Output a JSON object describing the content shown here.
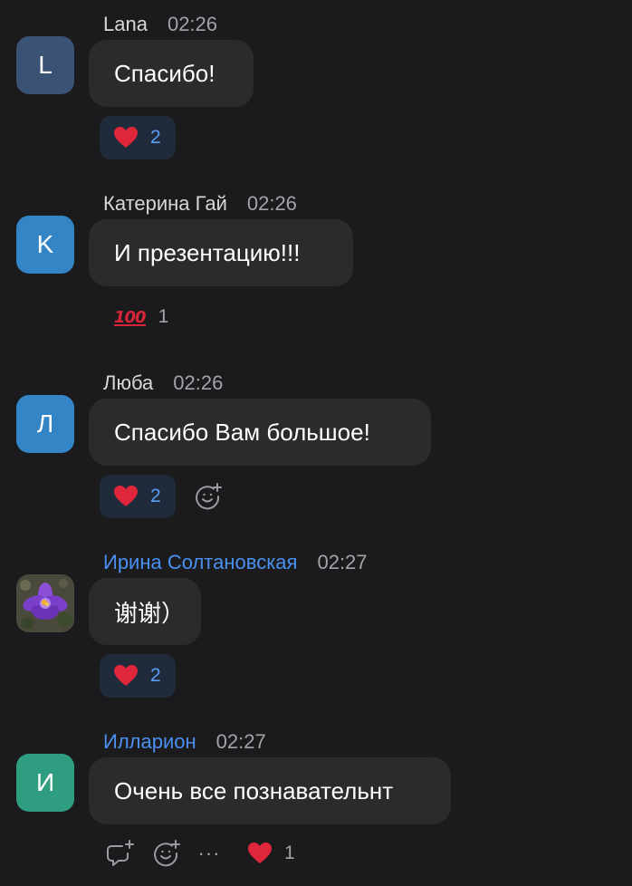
{
  "colors": {
    "background": "#1b1b1d",
    "bubble": "#2b2b2e",
    "reaction_active_bg": "#1f2a3b",
    "reaction_active_text": "#5a9ef5",
    "name_blue": "#4a90f0",
    "heart": "#e0263b"
  },
  "messages": [
    {
      "sender": "Lana",
      "time": "02:26",
      "avatar_letter": "L",
      "avatar_color": "#3a5273",
      "text": "Спасибо!",
      "reactions": [
        {
          "emoji": "heart-icon",
          "count": "2",
          "selected": true
        }
      ]
    },
    {
      "sender": "Катерина Гай",
      "time": "02:26",
      "avatar_letter": "K",
      "avatar_color": "#3385c6",
      "text": "И презентацию!!!",
      "reactions": [
        {
          "emoji": "hundred-points-icon",
          "count": "1",
          "selected": false
        }
      ]
    },
    {
      "sender": "Люба",
      "time": "02:26",
      "avatar_letter": "Л",
      "avatar_color": "#3385c6",
      "text": "Спасибо Вам большое!",
      "reactions": [
        {
          "emoji": "heart-icon",
          "count": "2",
          "selected": true
        }
      ],
      "actions": [
        "add-reaction-icon"
      ]
    },
    {
      "sender": "Ирина Солтановская",
      "time": "02:27",
      "avatar_image": "crocus-flower-photo",
      "text": "谢谢）",
      "reactions": [
        {
          "emoji": "heart-icon",
          "count": "2",
          "selected": true
        }
      ]
    },
    {
      "sender": "Илларион",
      "time": "02:27",
      "avatar_letter": "И",
      "avatar_color": "#2f9e80",
      "text": "Очень все познавательнт",
      "actions": [
        "reply-icon",
        "add-reaction-icon",
        "more-icon"
      ],
      "reactions": [
        {
          "emoji": "heart-icon",
          "count": "1",
          "selected": false
        }
      ]
    }
  ],
  "more_label": "···"
}
